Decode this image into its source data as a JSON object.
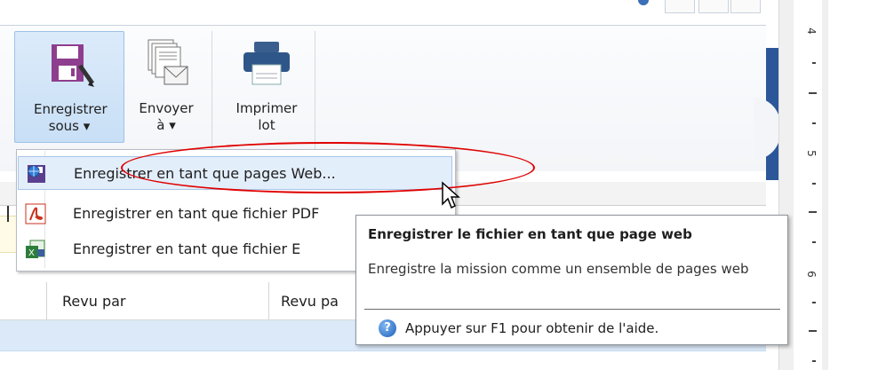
{
  "ribbon": {
    "buttons": [
      {
        "label": "Enregistrer sous ▾",
        "icon": "save-as-icon"
      },
      {
        "label": "Envoyer à ▾",
        "icon": "send-mail-icon"
      },
      {
        "label": "Imprimer lot",
        "icon": "printer-icon"
      }
    ]
  },
  "menu": {
    "items": [
      {
        "label": "Enregistrer en tant que pages Web...",
        "icon": "web-page-save-icon"
      },
      {
        "label": "Enregistrer en tant que fichier PDF",
        "icon": "pdf-icon"
      },
      {
        "label": "Enregistrer en tant que fichier E",
        "icon": "excel-icon"
      }
    ]
  },
  "grid": {
    "headers": [
      "Revu par",
      "Revu pa"
    ]
  },
  "tooltip": {
    "title": "Enregistrer le fichier en tant que page web",
    "body": "Enregistre la mission comme un ensemble de pages web",
    "help": "Appuyer sur F1 pour obtenir de l'aide."
  },
  "ruler": {
    "numbers": [
      "4",
      "5",
      "6"
    ]
  },
  "colors": {
    "accent": "#2b579a",
    "highlight": "#e3eefb",
    "annotation": "#e00000"
  }
}
